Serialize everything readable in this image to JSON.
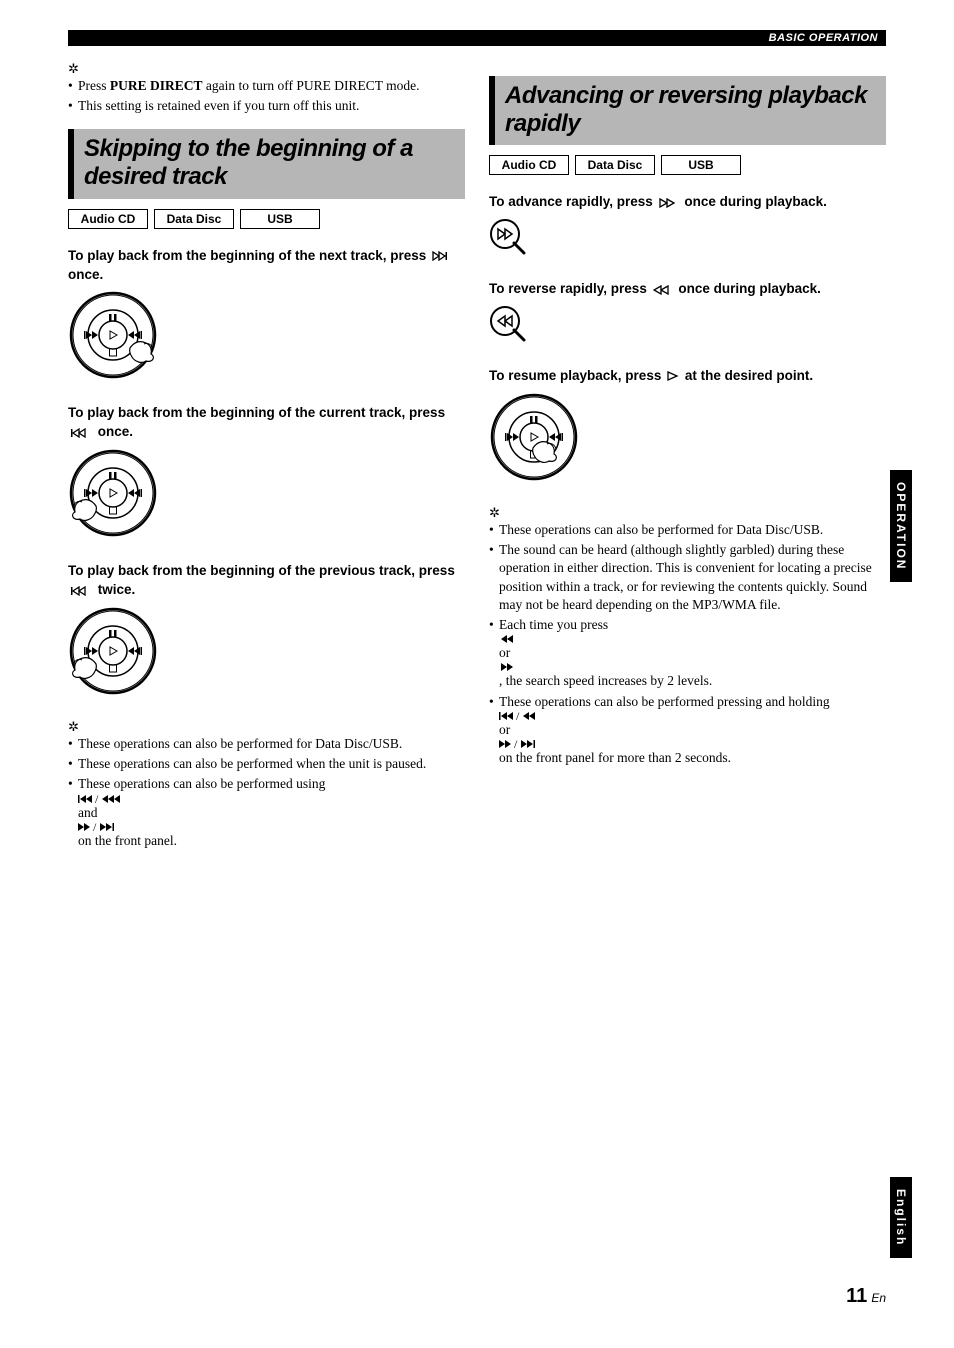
{
  "header": {
    "label": "BASIC OPERATION"
  },
  "left": {
    "tips1": [
      "Press PURE DIRECT again to turn off PURE DIRECT mode.",
      "This setting is retained even if you turn off this unit."
    ],
    "tip1_bold": "PURE DIRECT",
    "heading": "Skipping to the beginning of a desired track",
    "tags": [
      "Audio CD",
      "Data Disc",
      "USB"
    ],
    "instr1_a": "To play back from the beginning of the next track, press ",
    "instr1_b": " once.",
    "instr2_a": "To play back from the beginning of the current track, press ",
    "instr2_b": " once.",
    "instr3_a": "To play back from the beginning of the previous track, press ",
    "instr3_b": " twice.",
    "tips2": [
      "These operations can also be performed for Data Disc/USB.",
      "These operations can also be performed when the unit is paused.",
      "These operations can also be performed using ⏮/⏪ and ⏩/⏭ on the front panel."
    ]
  },
  "right": {
    "heading": "Advancing or reversing playback rapidly",
    "tags": [
      "Audio CD",
      "Data Disc",
      "USB"
    ],
    "instr1_a": "To advance rapidly, press ",
    "instr1_b": " once during playback.",
    "instr2_a": "To reverse rapidly, press ",
    "instr2_b": " once during playback.",
    "instr3_a": "To resume playback, press ",
    "instr3_b": " at the desired point.",
    "tips": [
      "These operations can also be performed for Data Disc/USB.",
      "The sound can be heard (although slightly garbled) during these operation in either direction. This is convenient for locating a precise position within a track, or for reviewing the contents quickly. Sound may not be heard depending on the MP3/WMA file.",
      "Each time you press ⏪ or ⏩ , the search speed increases by 2 levels.",
      "These operations can also be performed pressing and holding ⏮/⏪ or ⏩/⏭ on the front panel for more than 2 seconds."
    ]
  },
  "side": {
    "operation": "OPERATION",
    "lang": "English"
  },
  "footer": {
    "page": "11",
    "suffix": "En"
  }
}
